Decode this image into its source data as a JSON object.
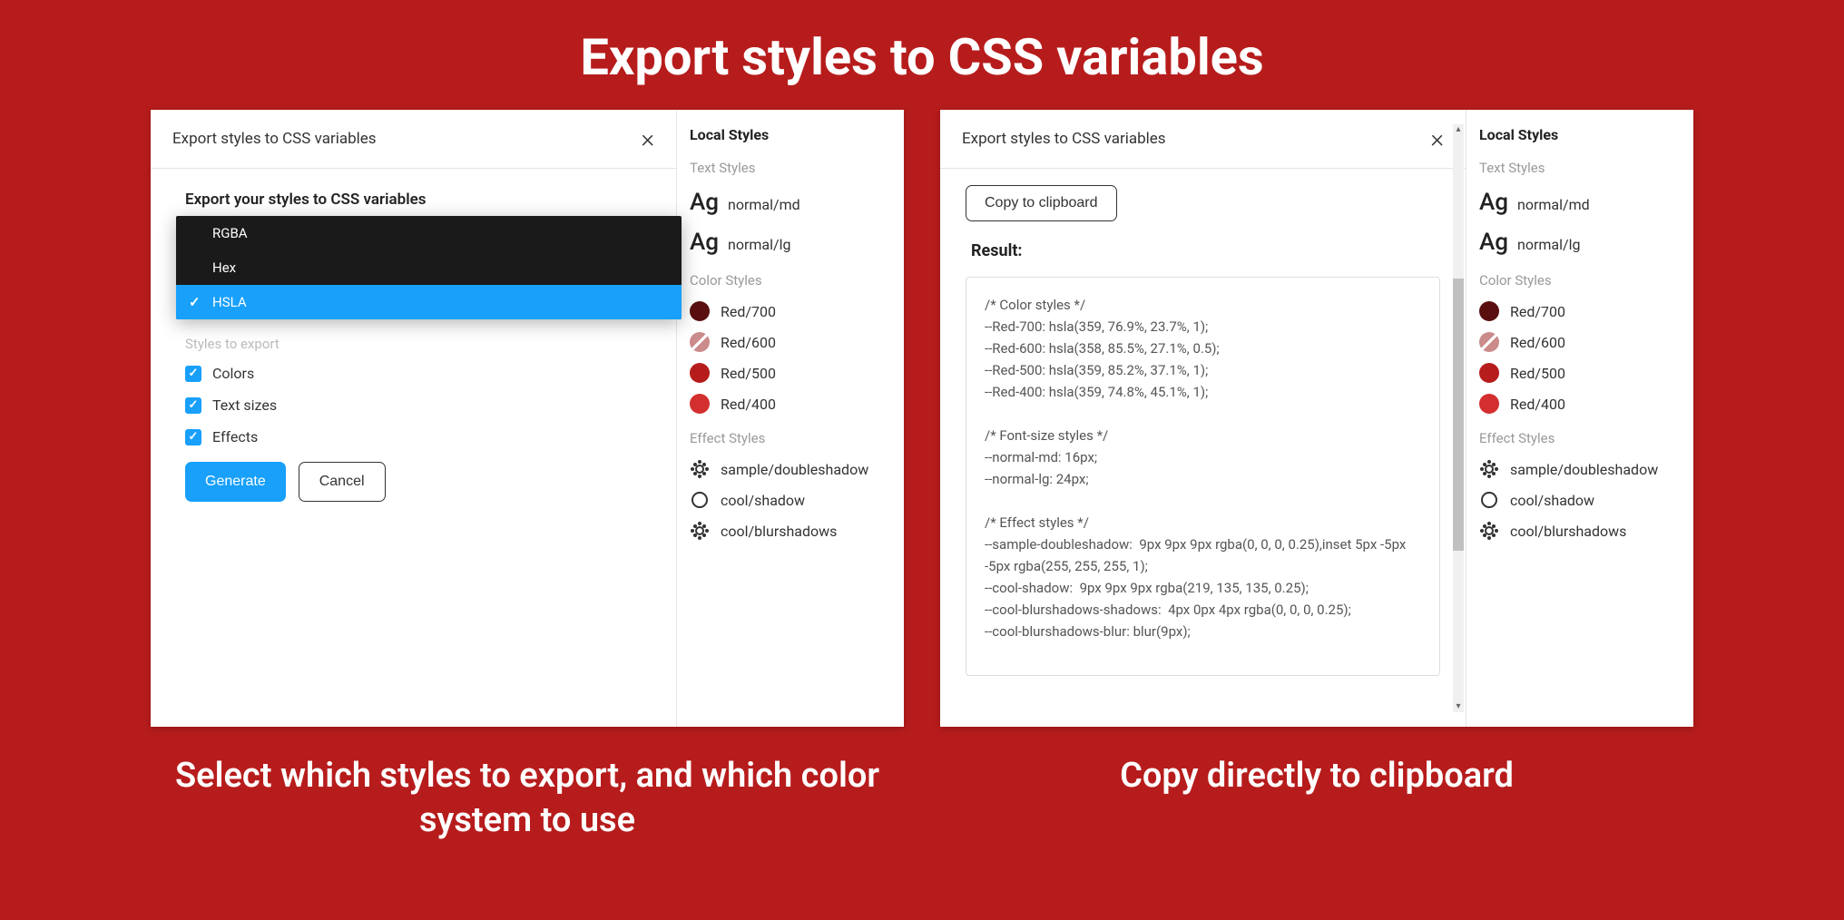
{
  "page": {
    "title": "Export styles to CSS variables"
  },
  "leftPanel": {
    "modal": {
      "title": "Export styles to CSS variables",
      "heading": "Export your styles to CSS variables",
      "dropdown": {
        "options": [
          "RGBA",
          "Hex",
          "HSLA"
        ],
        "selected": "HSLA"
      },
      "stylesLabel": "Styles to export",
      "checkboxes": {
        "colors": "Colors",
        "textSizes": "Text sizes",
        "effects": "Effects"
      },
      "buttons": {
        "generate": "Generate",
        "cancel": "Cancel"
      }
    },
    "caption": "Select which styles to export, and which color system to use"
  },
  "rightPanel": {
    "modal": {
      "title": "Export styles to CSS variables",
      "copyButton": "Copy to clipboard",
      "resultLabel": "Result:",
      "code": "/* Color styles */\n--Red-700: hsla(359, 76.9%, 23.7%, 1);\n--Red-600: hsla(358, 85.5%, 27.1%, 0.5);\n--Red-500: hsla(359, 85.2%, 37.1%, 1);\n--Red-400: hsla(359, 74.8%, 45.1%, 1);\n\n/* Font-size styles */\n--normal-md: 16px;\n--normal-lg: 24px;\n\n/* Effect styles */\n--sample-doubleshadow:  9px 9px 9px rgba(0, 0, 0, 0.25),inset 5px -5px -5px rgba(255, 255, 255, 1);\n--cool-shadow:  9px 9px 9px rgba(219, 135, 135, 0.25);\n--cool-blurshadows-shadows:  4px 0px 4px rgba(0, 0, 0, 0.25);\n--cool-blurshadows-blur: blur(9px);"
    },
    "caption": "Copy directly to clipboard"
  },
  "sidebar": {
    "heading": "Local Styles",
    "textStylesLabel": "Text Styles",
    "textStyles": [
      {
        "label": "normal/md"
      },
      {
        "label": "normal/lg"
      }
    ],
    "colorStylesLabel": "Color Styles",
    "colorStyles": [
      {
        "label": "Red/700",
        "color": "#5a0f0f"
      },
      {
        "label": "Red/600",
        "color": "#cb8b8b",
        "striped": true
      },
      {
        "label": "Red/500",
        "color": "#b71c1c"
      },
      {
        "label": "Red/400",
        "color": "#d32f2f"
      }
    ],
    "effectStylesLabel": "Effect Styles",
    "effectStyles": [
      {
        "label": "sample/doubleshadow",
        "icon": "sun"
      },
      {
        "label": "cool/shadow",
        "icon": "ring"
      },
      {
        "label": "cool/blurshadows",
        "icon": "sun"
      }
    ]
  }
}
